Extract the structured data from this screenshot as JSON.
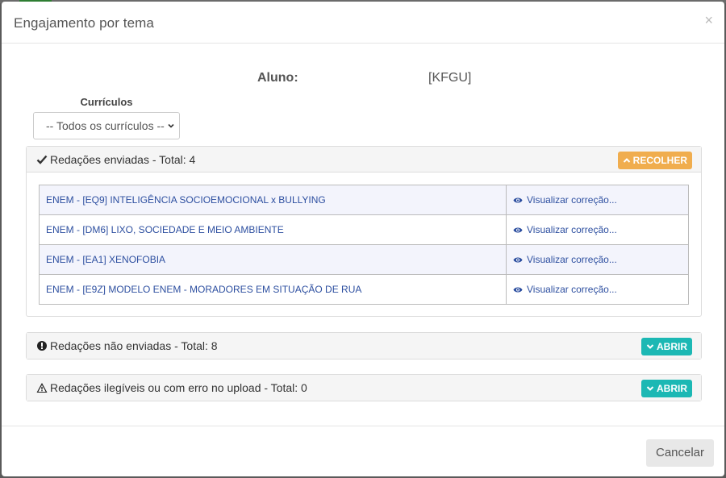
{
  "modal": {
    "title": "Engajamento por tema",
    "close_glyph": "×"
  },
  "student": {
    "label": "Aluno:",
    "name": "[KFGU]"
  },
  "curriculum": {
    "label": "Currículos",
    "selected": "-- Todos os currículos --"
  },
  "panels": {
    "sent": {
      "icon": "check-icon",
      "title": "Redações enviadas - Total: 4",
      "button": "RECOLHER",
      "button_color": "#f0ad4e",
      "items": [
        {
          "topic": "ENEM - [EQ9] INTELIGÊNCIA SOCIOEMOCIONAL x BULLYING",
          "action": "Visualizar correção..."
        },
        {
          "topic": "ENEM - [DM6] LIXO, SOCIEDADE E MEIO AMBIENTE",
          "action": "Visualizar correção..."
        },
        {
          "topic": "ENEM - [EA1] XENOFOBIA",
          "action": "Visualizar correção..."
        },
        {
          "topic": "ENEM - [E9Z] MODELO ENEM - MORADORES EM SITUAÇÃO DE RUA",
          "action": "Visualizar correção..."
        }
      ]
    },
    "not_sent": {
      "icon": "exclamation-circle-icon",
      "title": "Redações não enviadas - Total: 8",
      "button": "ABRIR",
      "button_color": "#1cb8b4"
    },
    "illegible": {
      "icon": "warning-icon",
      "title": "Redações ilegíveis ou com erro no upload - Total: 0",
      "button": "ABRIR",
      "button_color": "#1cb8b4"
    }
  },
  "footer": {
    "cancel": "Cancelar"
  }
}
